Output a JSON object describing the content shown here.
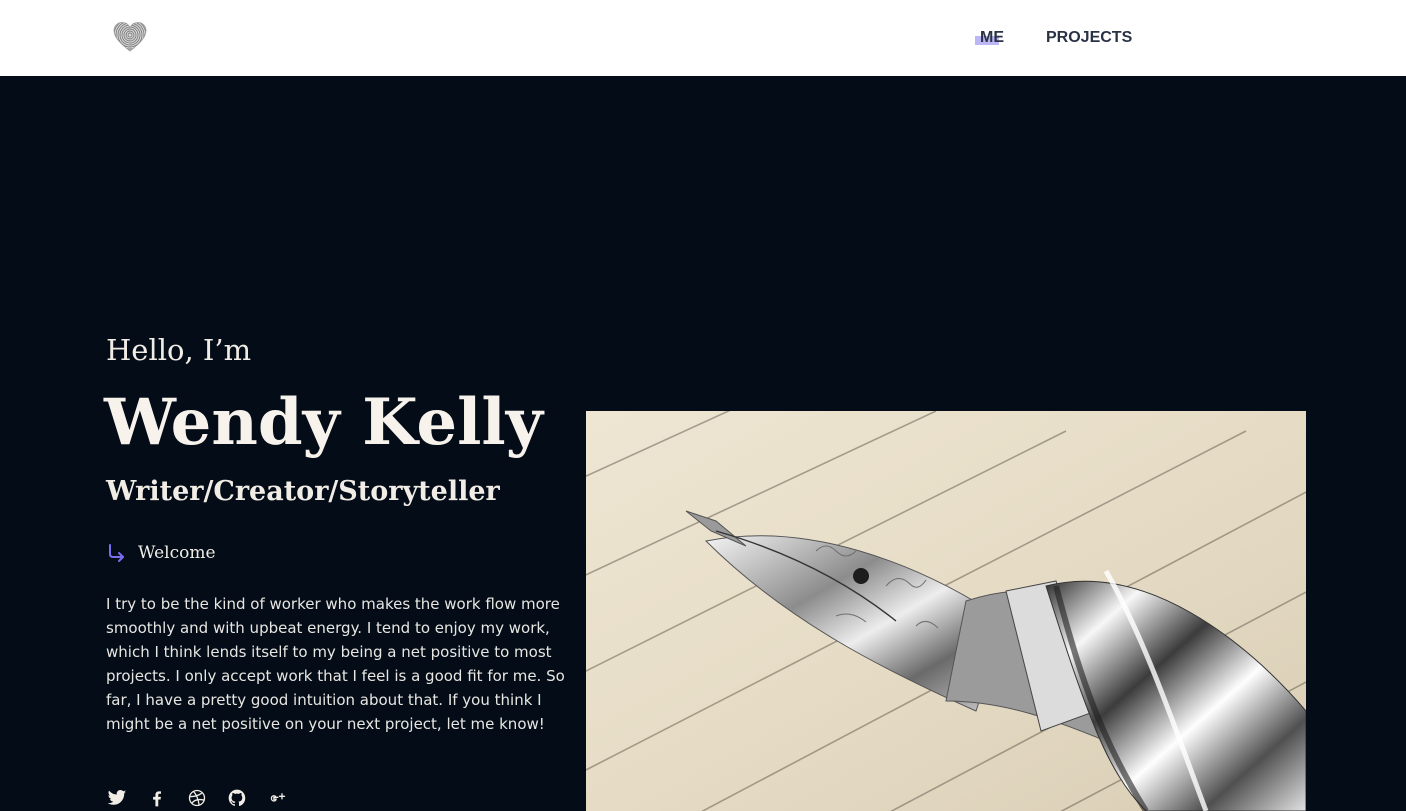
{
  "header": {
    "nav": [
      {
        "label": "ME",
        "active": true
      },
      {
        "label": "PROJECTS",
        "active": false
      }
    ],
    "logo_icon": "fingerprint-heart-icon"
  },
  "hero": {
    "greeting": "Hello, I’m",
    "name": "Wendy Kelly",
    "role": "Writer/Creator/Storyteller",
    "welcome_link": "Welcome",
    "welcome_icon": "arrow-down-right-icon",
    "bio": "I try to be the kind of worker who makes the work flow more smoothly and with upbeat energy. I tend to enjoy my work, which I think lends itself to my being a net positive to most projects. I only accept work that I feel is a good fit for me. So far, I have a pretty good intuition about that. If you think I might be a net positive on your next project, let me know!",
    "socials": [
      "twitter-icon",
      "facebook-icon",
      "dribbble-icon",
      "github-icon",
      "google-plus-icon"
    ],
    "image": "fountain-pen-photo"
  },
  "colors": {
    "background": "#030c17",
    "accent": "#7b6ef0",
    "highlight": "#bdb6f6",
    "header_bg": "#ffffff",
    "nav_text": "#2a3346"
  }
}
